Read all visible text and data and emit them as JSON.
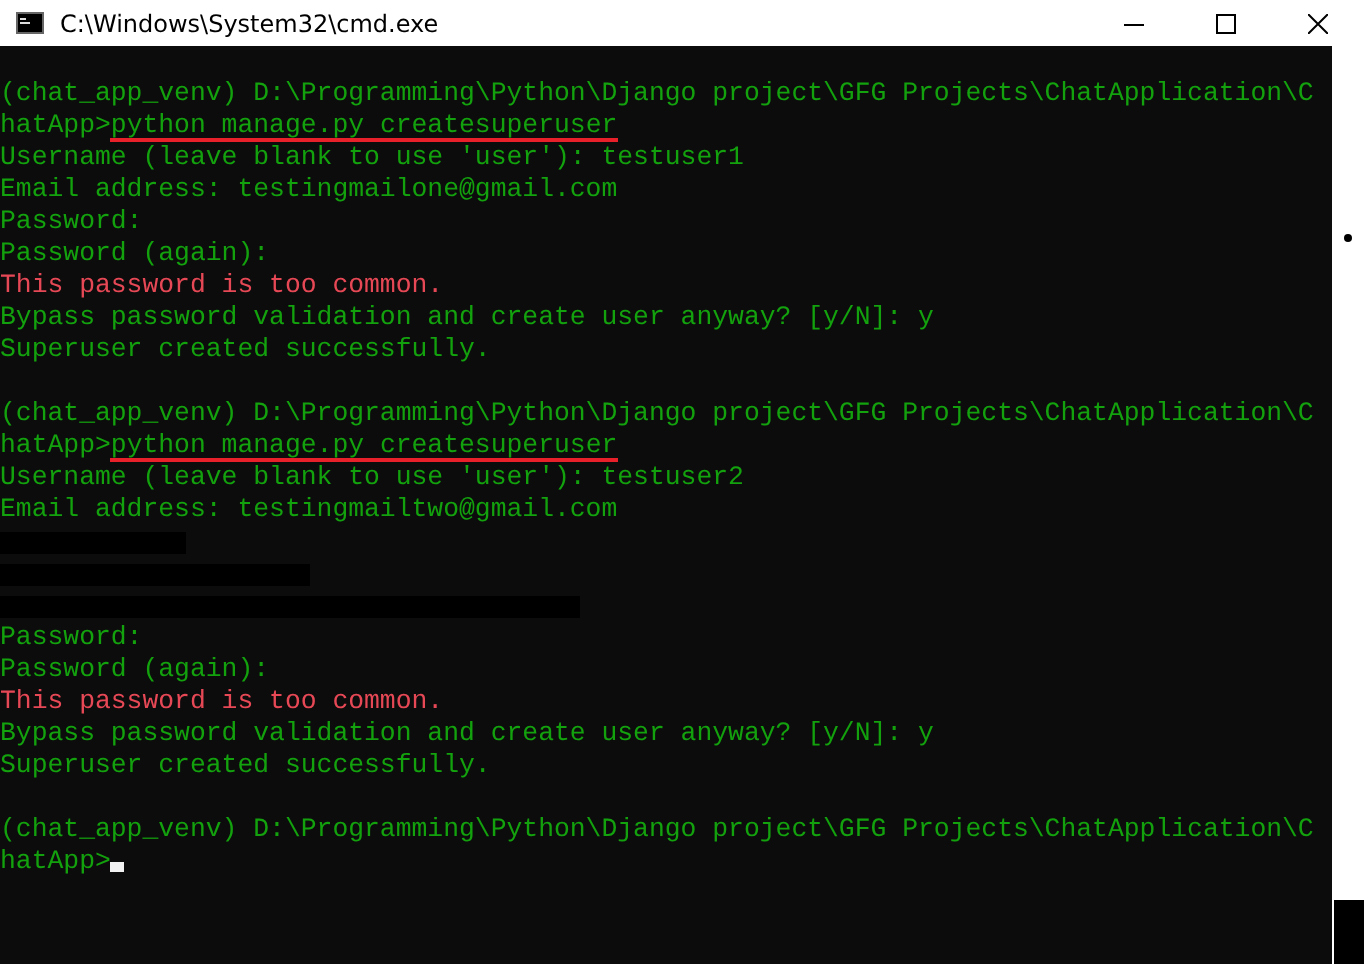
{
  "window": {
    "title": "C:\\Windows\\System32\\cmd.exe"
  },
  "console": {
    "lines": [
      {
        "kind": "text",
        "segments": [
          {
            "text": "(chat_app_venv) D:\\Programming\\Python\\Django project\\GFG Projects\\ChatApplication\\C",
            "underlined": false
          }
        ]
      },
      {
        "kind": "text",
        "segments": [
          {
            "text": "hatApp>",
            "underlined": false
          },
          {
            "text": "python manage.py createsuperuser",
            "underlined": true
          }
        ]
      },
      {
        "kind": "text",
        "segments": [
          {
            "text": "Username (leave blank to use 'user'): testuser1",
            "underlined": false
          }
        ]
      },
      {
        "kind": "text",
        "segments": [
          {
            "text": "Email address: testingmailone@gmail.com",
            "underlined": false
          }
        ]
      },
      {
        "kind": "text",
        "segments": [
          {
            "text": "Password:",
            "underlined": false
          }
        ]
      },
      {
        "kind": "text",
        "segments": [
          {
            "text": "Password (again):",
            "underlined": false
          }
        ]
      },
      {
        "kind": "error",
        "segments": [
          {
            "text": "This password is too common.",
            "underlined": false
          }
        ]
      },
      {
        "kind": "text",
        "segments": [
          {
            "text": "Bypass password validation and create user anyway? [y/N]: y",
            "underlined": false
          }
        ]
      },
      {
        "kind": "text",
        "segments": [
          {
            "text": "Superuser created successfully.",
            "underlined": false
          }
        ]
      },
      {
        "kind": "blank"
      },
      {
        "kind": "text",
        "segments": [
          {
            "text": "(chat_app_venv) D:\\Programming\\Python\\Django project\\GFG Projects\\ChatApplication\\C",
            "underlined": false
          }
        ]
      },
      {
        "kind": "text",
        "segments": [
          {
            "text": "hatApp>",
            "underlined": false
          },
          {
            "text": "python manage.py createsuperuser",
            "underlined": true
          }
        ]
      },
      {
        "kind": "text",
        "segments": [
          {
            "text": "Username (leave blank to use 'user'): testuser2",
            "underlined": false
          }
        ]
      },
      {
        "kind": "text",
        "segments": [
          {
            "text": "Email address: testingmailtwo@gmail.com",
            "underlined": false
          }
        ]
      },
      {
        "kind": "redacted"
      },
      {
        "kind": "redacted"
      },
      {
        "kind": "redacted"
      },
      {
        "kind": "text",
        "segments": [
          {
            "text": "Password:",
            "underlined": false
          }
        ]
      },
      {
        "kind": "text",
        "segments": [
          {
            "text": "Password (again):",
            "underlined": false
          }
        ]
      },
      {
        "kind": "error",
        "segments": [
          {
            "text": "This password is too common.",
            "underlined": false
          }
        ]
      },
      {
        "kind": "text",
        "segments": [
          {
            "text": "Bypass password validation and create user anyway? [y/N]: y",
            "underlined": false
          }
        ]
      },
      {
        "kind": "text",
        "segments": [
          {
            "text": "Superuser created successfully.",
            "underlined": false
          }
        ]
      },
      {
        "kind": "blank"
      },
      {
        "kind": "text",
        "segments": [
          {
            "text": "(chat_app_venv) D:\\Programming\\Python\\Django project\\GFG Projects\\ChatApplication\\C",
            "underlined": false
          }
        ]
      },
      {
        "kind": "prompt",
        "segments": [
          {
            "text": "hatApp>",
            "underlined": false
          }
        ]
      }
    ]
  }
}
